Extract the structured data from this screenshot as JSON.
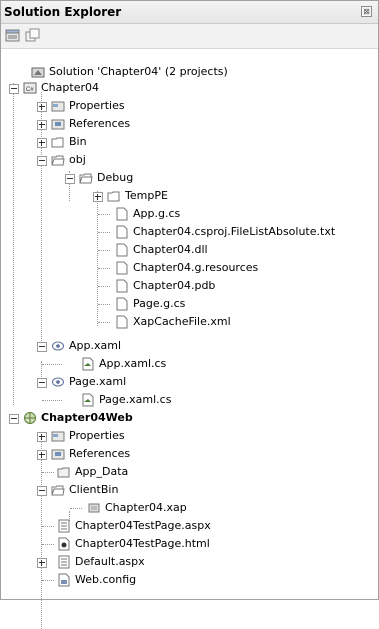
{
  "window": {
    "title": "Solution Explorer",
    "pin_glyph": "⊠"
  },
  "toolbar": {
    "buttons": [
      {
        "icon": "properties-icon"
      },
      {
        "icon": "show-all-files-icon"
      }
    ]
  },
  "tree": [
    {
      "label": "Solution 'Chapter04' (2 projects)",
      "icon": "solution-icon"
    },
    {
      "label": "Chapter04",
      "icon": "project-cs-icon"
    },
    {
      "label": "Properties",
      "icon": "properties-folder-icon"
    },
    {
      "label": "References",
      "icon": "references-icon"
    },
    {
      "label": "Bin",
      "icon": "folder-icon"
    },
    {
      "label": "obj",
      "icon": "folder-open-icon"
    },
    {
      "label": "Debug",
      "icon": "folder-open-icon"
    },
    {
      "label": "TempPE",
      "icon": "folder-icon"
    },
    {
      "label": "App.g.cs",
      "icon": "file-icon"
    },
    {
      "label": "Chapter04.csproj.FileListAbsolute.txt",
      "icon": "file-icon"
    },
    {
      "label": "Chapter04.dll",
      "icon": "file-icon"
    },
    {
      "label": "Chapter04.g.resources",
      "icon": "file-icon"
    },
    {
      "label": "Chapter04.pdb",
      "icon": "file-icon"
    },
    {
      "label": "Page.g.cs",
      "icon": "file-icon"
    },
    {
      "label": "XapCacheFile.xml",
      "icon": "file-icon"
    },
    {
      "label": "App.xaml",
      "icon": "xaml-icon"
    },
    {
      "label": "App.xaml.cs",
      "icon": "cs-file-icon"
    },
    {
      "label": "Page.xaml",
      "icon": "xaml-icon"
    },
    {
      "label": "Page.xaml.cs",
      "icon": "cs-file-icon"
    },
    {
      "label": "Chapter04Web",
      "icon": "web-project-icon"
    },
    {
      "label": "Properties",
      "icon": "properties-folder-icon"
    },
    {
      "label": "References",
      "icon": "references-icon"
    },
    {
      "label": "App_Data",
      "icon": "folder-icon"
    },
    {
      "label": "ClientBin",
      "icon": "folder-open-icon"
    },
    {
      "label": "Chapter04.xap",
      "icon": "xap-file-icon"
    },
    {
      "label": "Chapter04TestPage.aspx",
      "icon": "aspx-file-icon"
    },
    {
      "label": "Chapter04TestPage.html",
      "icon": "html-file-icon"
    },
    {
      "label": "Default.aspx",
      "icon": "aspx-file-icon"
    },
    {
      "label": "Web.config",
      "icon": "config-file-icon"
    }
  ]
}
